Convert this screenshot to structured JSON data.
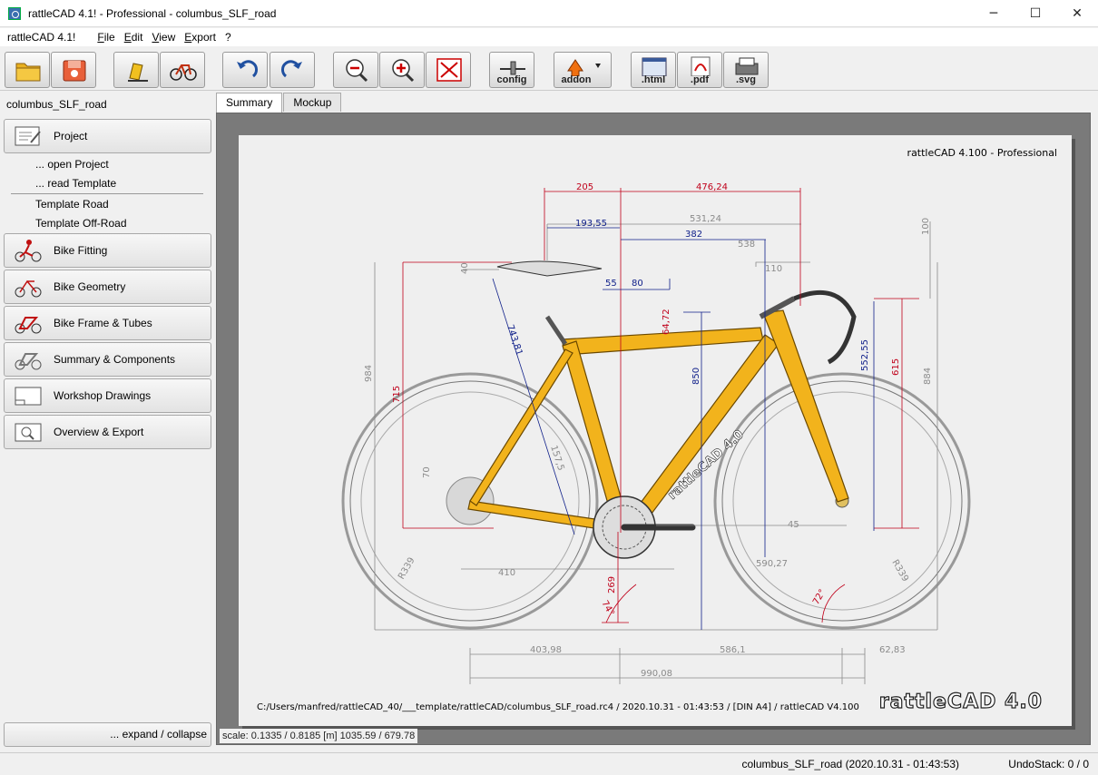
{
  "window": {
    "title": "rattleCAD 4.1! - Professional  - columbus_SLF_road",
    "minimize": "─",
    "maximize": "☐",
    "close": "✕"
  },
  "menubar": {
    "brand": "rattleCAD 4.1!",
    "items": [
      "File",
      "Edit",
      "View",
      "Export",
      "?"
    ]
  },
  "toolbar": {
    "config_label": "config",
    "addon_label": "addon",
    "html_label": ".html",
    "pdf_label": ".pdf",
    "svg_label": ".svg"
  },
  "sidebar": {
    "project_name": "columbus_SLF_road",
    "sections": [
      "Project",
      "Bike Fitting",
      "Bike Geometry",
      "Bike Frame & Tubes",
      "Summary & Components",
      "Workshop Drawings",
      "Overview & Export"
    ],
    "project_items": [
      "... open Project",
      "... read Template"
    ],
    "templates": [
      "Template Road",
      "Template Off-Road"
    ],
    "expand_collapse": "... expand / collapse"
  },
  "tabs": [
    "Summary",
    "Mockup"
  ],
  "drawing": {
    "header": "rattleCAD  4.100  -  Professional",
    "footer": "C:/Users/manfred/rattleCAD_40/___template/rattleCAD/columbus_SLF_road.rc4   /   2020.10.31 - 01:43:53   /   [DIN A4]   /   rattleCAD   V4.100",
    "logo": "rattleCAD 4.0",
    "down_tube_text": "rattleCAD 4.0",
    "dims": {
      "d205": "205",
      "d476": "476,24",
      "d193": "193,55",
      "d531": "531,24",
      "d382": "382",
      "d538": "538",
      "d100": "100",
      "d110": "110",
      "d40": "40",
      "d55": "55",
      "d80": "80",
      "d64": "64,72",
      "d743": "743,81",
      "d715": "715",
      "d984": "984",
      "d850": "850",
      "d552": "552,55",
      "d615": "615",
      "d884": "884",
      "d70": "70",
      "d45": "45",
      "d410": "410",
      "d269": "269",
      "d590": "590,27",
      "r339a": "R339",
      "r339b": "R339",
      "a74": "74°",
      "a72": "72°",
      "d403": "403,98",
      "d586": "586,1",
      "d62": "62,83",
      "d990": "990,08",
      "d1575": "157,5"
    }
  },
  "scale_readout": "scale: 0.1335 / 0.8185  [m]  1035.59 / 679.78",
  "status": {
    "file": "columbus_SLF_road (2020.10.31 - 01:43:53)",
    "undo": "UndoStack:  0 /  0"
  },
  "colors": {
    "frame_yellow": "#f2b31c",
    "dim_red": "#c0001a",
    "dim_blue": "#10208a",
    "dim_gray": "#8a8a8a"
  }
}
